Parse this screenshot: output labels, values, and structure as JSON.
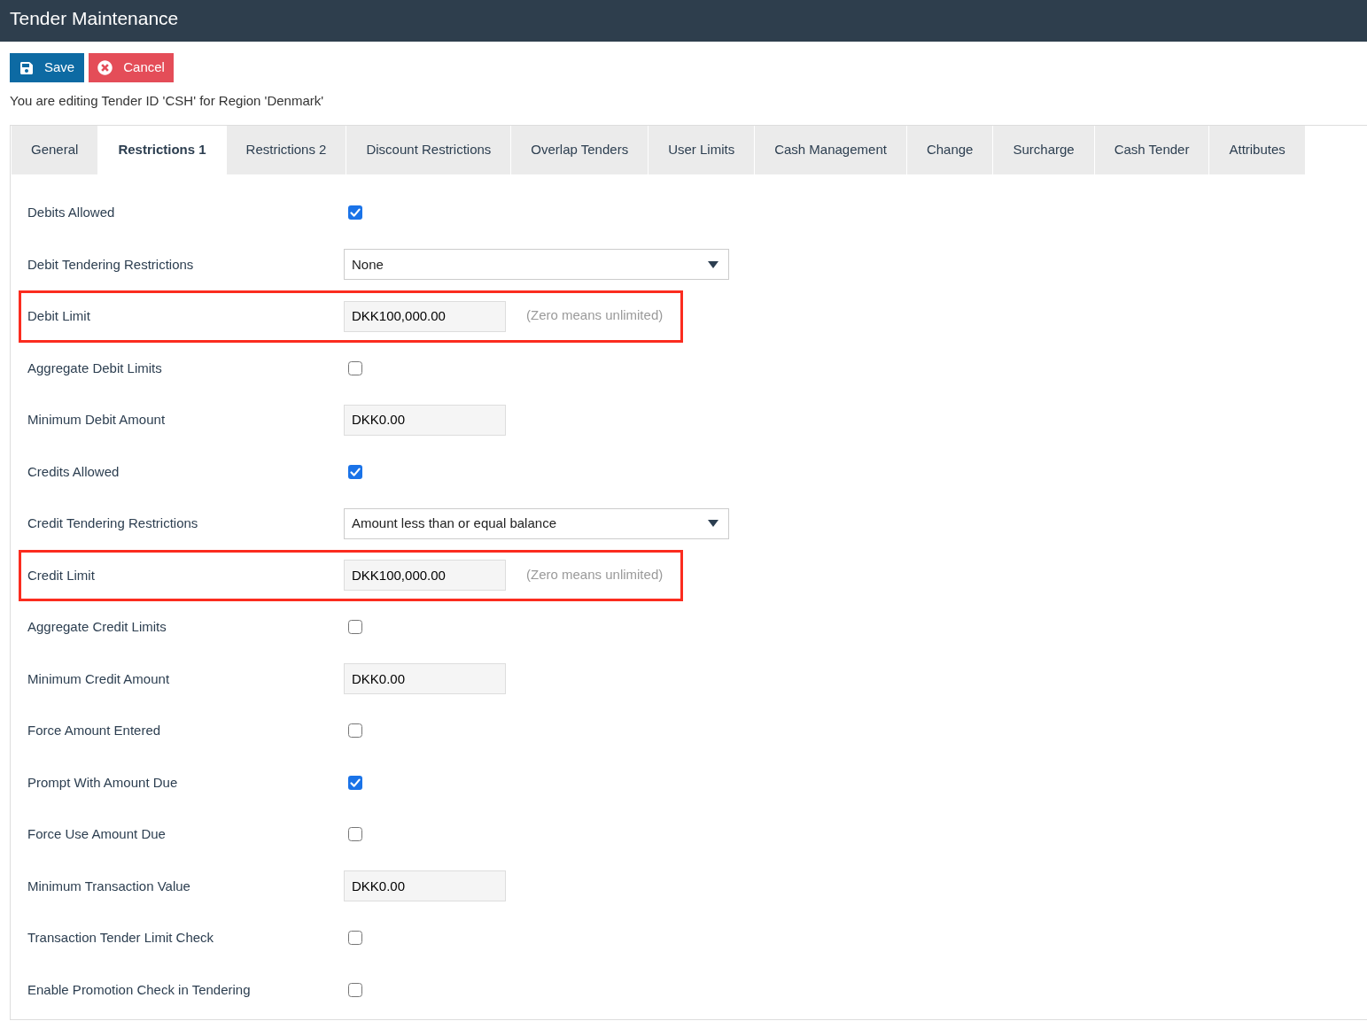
{
  "header": {
    "title": "Tender Maintenance"
  },
  "toolbar": {
    "buttons": [
      {
        "label": "Save",
        "kind": "save"
      },
      {
        "label": "Cancel",
        "kind": "cancel"
      }
    ]
  },
  "context_text": "You are editing Tender ID 'CSH' for Region 'Denmark'",
  "tabs": [
    {
      "label": "General",
      "selected": false
    },
    {
      "label": "Restrictions 1",
      "selected": true
    },
    {
      "label": "Restrictions 2",
      "selected": false
    },
    {
      "label": "Discount Restrictions",
      "selected": false
    },
    {
      "label": "Overlap Tenders",
      "selected": false
    },
    {
      "label": "User Limits",
      "selected": false
    },
    {
      "label": "Cash Management",
      "selected": false
    },
    {
      "label": "Change",
      "selected": false
    },
    {
      "label": "Surcharge",
      "selected": false
    },
    {
      "label": "Cash Tender",
      "selected": false
    },
    {
      "label": "Attributes",
      "selected": false
    }
  ],
  "form": {
    "rows": [
      {
        "label": "Debits Allowed",
        "kind": "checkbox",
        "checked": true,
        "highlighted": false
      },
      {
        "label": "Debit Tendering Restrictions",
        "kind": "select",
        "value": "None",
        "highlighted": false
      },
      {
        "label": "Debit Limit",
        "kind": "input",
        "value": "DKK100,000.00",
        "hint": "(Zero means unlimited)",
        "highlighted": true
      },
      {
        "label": "Aggregate Debit Limits",
        "kind": "checkbox",
        "checked": false,
        "highlighted": false
      },
      {
        "label": "Minimum Debit Amount",
        "kind": "input",
        "value": "DKK0.00",
        "highlighted": false
      },
      {
        "label": "Credits Allowed",
        "kind": "checkbox",
        "checked": true,
        "highlighted": false
      },
      {
        "label": "Credit Tendering Restrictions",
        "kind": "select",
        "value": "Amount less than or equal balance",
        "highlighted": false
      },
      {
        "label": "Credit Limit",
        "kind": "input",
        "value": "DKK100,000.00",
        "hint": "(Zero means unlimited)",
        "highlighted": true
      },
      {
        "label": "Aggregate Credit Limits",
        "kind": "checkbox",
        "checked": false,
        "highlighted": false
      },
      {
        "label": "Minimum Credit Amount",
        "kind": "input",
        "value": "DKK0.00",
        "highlighted": false
      },
      {
        "label": "Force Amount Entered",
        "kind": "checkbox",
        "checked": false,
        "highlighted": false
      },
      {
        "label": "Prompt With Amount Due",
        "kind": "checkbox",
        "checked": true,
        "highlighted": false
      },
      {
        "label": "Force Use Amount Due",
        "kind": "checkbox",
        "checked": false,
        "highlighted": false
      },
      {
        "label": "Minimum Transaction Value",
        "kind": "input",
        "value": "DKK0.00",
        "highlighted": false
      },
      {
        "label": "Transaction Tender Limit Check",
        "kind": "checkbox",
        "checked": false,
        "highlighted": false
      },
      {
        "label": "Enable Promotion Check in Tendering",
        "kind": "checkbox",
        "checked": false,
        "highlighted": false
      }
    ]
  }
}
